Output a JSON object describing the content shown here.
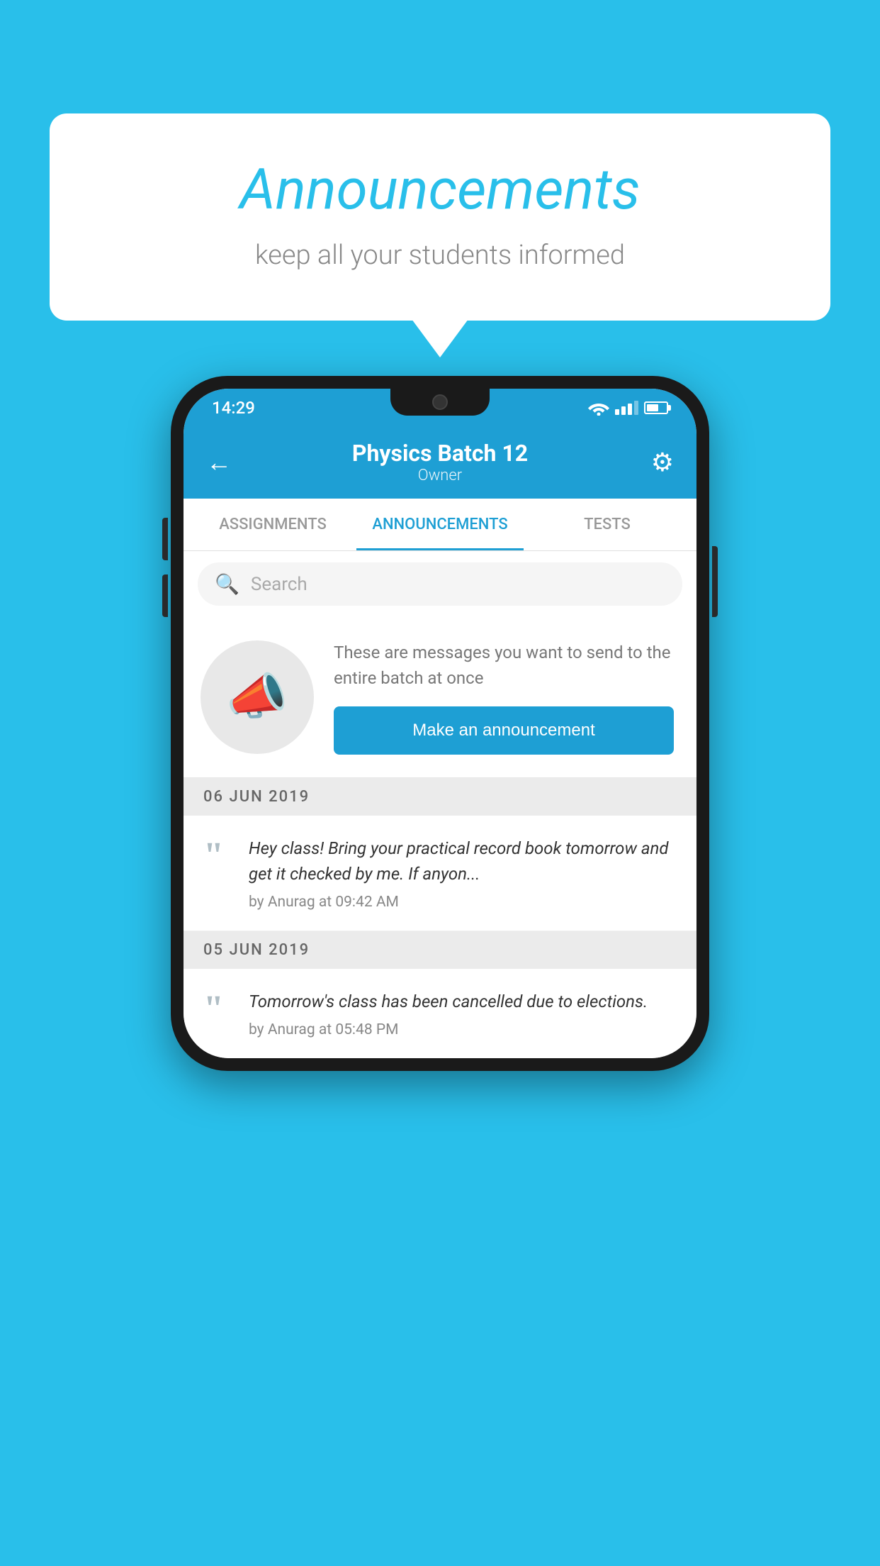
{
  "background_color": "#29BFEA",
  "speech_bubble": {
    "title": "Announcements",
    "subtitle": "keep all your students informed"
  },
  "phone": {
    "status_bar": {
      "time": "14:29"
    },
    "header": {
      "title": "Physics Batch 12",
      "subtitle": "Owner",
      "back_label": "←",
      "gear_label": "⚙"
    },
    "tabs": [
      {
        "label": "ASSIGNMENTS",
        "active": false
      },
      {
        "label": "ANNOUNCEMENTS",
        "active": true
      },
      {
        "label": "TESTS",
        "active": false
      }
    ],
    "search": {
      "placeholder": "Search"
    },
    "announcement_prompt": {
      "description": "These are messages you want to send to the entire batch at once",
      "button_label": "Make an announcement"
    },
    "announcements": [
      {
        "date": "06  JUN  2019",
        "text": "Hey class! Bring your practical record book tomorrow and get it checked by me. If anyon...",
        "meta": "by Anurag at 09:42 AM"
      },
      {
        "date": "05  JUN  2019",
        "text": "Tomorrow's class has been cancelled due to elections.",
        "meta": "by Anurag at 05:48 PM"
      }
    ]
  }
}
